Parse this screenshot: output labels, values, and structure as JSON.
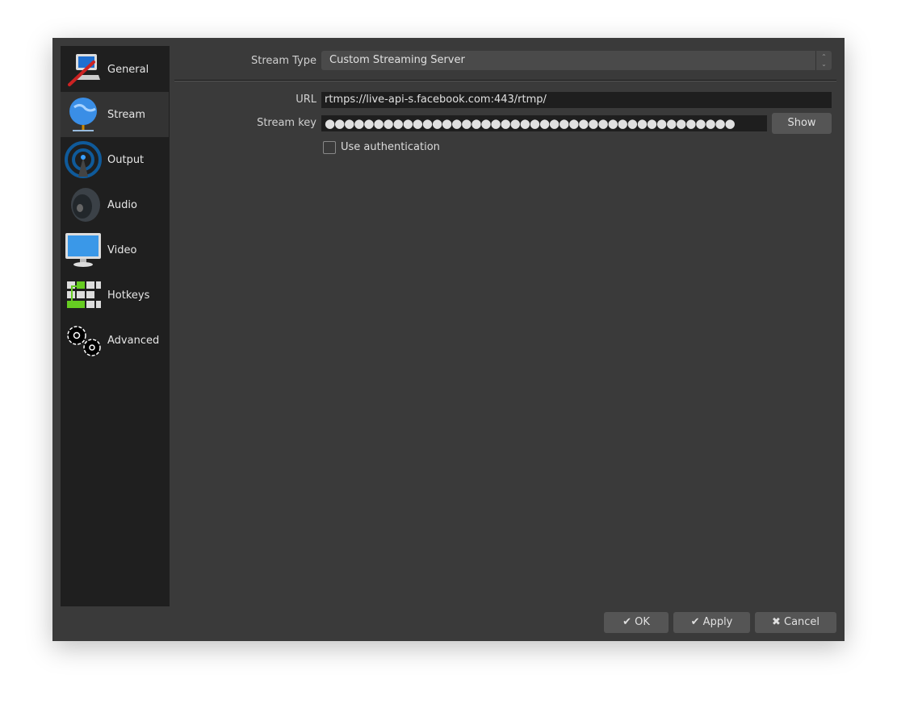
{
  "sidebar": {
    "items": [
      {
        "label": "General",
        "icon": "general-settings-icon"
      },
      {
        "label": "Stream",
        "icon": "globe-network-icon",
        "selected": true
      },
      {
        "label": "Output",
        "icon": "broadcast-antenna-icon"
      },
      {
        "label": "Audio",
        "icon": "speaker-icon"
      },
      {
        "label": "Video",
        "icon": "monitor-icon"
      },
      {
        "label": "Hotkeys",
        "icon": "keyboard-icon"
      },
      {
        "label": "Advanced",
        "icon": "gears-icon"
      }
    ]
  },
  "stream": {
    "type_label": "Stream Type",
    "type_value": "Custom Streaming Server",
    "url_label": "URL",
    "url_value": "rtmps://live-api-s.facebook.com:443/rtmp/",
    "key_label": "Stream key",
    "key_value": "●●●●●●●●●●●●●●●●●●●●●●●●●●●●●●●●●●●●●●●●●●",
    "show_label": "Show",
    "auth_label": "Use authentication",
    "auth_checked": false
  },
  "footer": {
    "ok": "OK",
    "apply": "Apply",
    "cancel": "Cancel"
  }
}
